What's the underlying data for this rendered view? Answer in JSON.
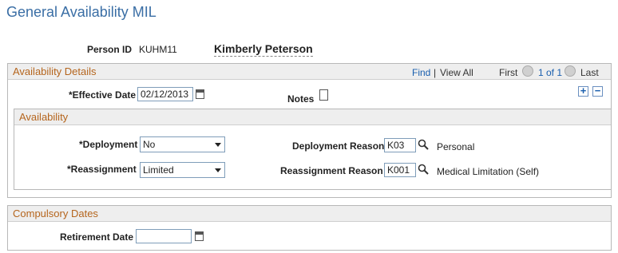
{
  "page": {
    "title": "General Availability MIL"
  },
  "person": {
    "id_label": "Person ID",
    "id_value": "KUHM11",
    "name": "Kimberly Peterson"
  },
  "availability_details": {
    "header": "Availability Details",
    "nav": {
      "find": "Find",
      "separator": "|",
      "view_all": "View All",
      "first": "First",
      "counter": "1 of 1",
      "last": "Last"
    },
    "effective_date_label": "*Effective Date",
    "effective_date_value": "02/12/2013",
    "notes_label": "Notes"
  },
  "availability": {
    "header": "Availability",
    "deployment_label": "*Deployment",
    "deployment_value": "No",
    "deployment_reason_label": "Deployment Reason",
    "deployment_reason_code": "K03",
    "deployment_reason_desc": "Personal",
    "reassignment_label": "*Reassignment",
    "reassignment_value": "Limited",
    "reassignment_reason_label": "Reassignment Reason",
    "reassignment_reason_code": "K001",
    "reassignment_reason_desc": "Medical Limitation (Self)"
  },
  "compulsory_dates": {
    "header": "Compulsory Dates",
    "retirement_label": "Retirement Date",
    "retirement_value": ""
  },
  "colors": {
    "title": "#3a6ea5",
    "section_header_text": "#b5651d",
    "link": "#1a5fae"
  }
}
